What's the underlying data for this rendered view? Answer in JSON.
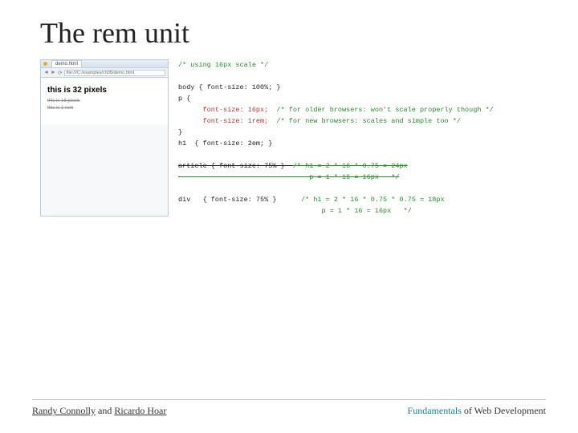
{
  "title": "The rem unit",
  "browser": {
    "tab": "demo.html",
    "url": "file:///C:/examples/ch05/demo.html",
    "heading": "this is 32 pixels",
    "line1": "this is 16 pixels",
    "line2": "this is 1 rem"
  },
  "code": {
    "l01": "/* using 16px scale */",
    "l02": "body { font-size: 100%; }",
    "l03": "p {",
    "l04a": "      font-size: 16px;",
    "l04b": "  /* for older browsers: won't scale properly though */",
    "l05a": "      font-size: 1rem;",
    "l05b": "  /* for new browsers: scales and simple too */",
    "l06": "}",
    "l07": "h1  { font-size: 2em; }",
    "l08a": "article { font-size: 75% }  ",
    "l08b": "/* h1 = 2 * 16 * 0.75 = 24px",
    "l09": "                                p = 1 * 16 = 16px   */",
    "l10a": "div   { font-size: 75% }",
    "l10b": "      /* h1 = 2 * 16 * 0.75 * 0.75 = 18px",
    "l11": "                                   p = 1 * 16 = 16px   */"
  },
  "footer": {
    "author1": "Randy Connolly",
    "and": " and ",
    "author2": "Ricardo Hoar",
    "book_a": "Fundamentals",
    "book_b": " of Web Development"
  }
}
